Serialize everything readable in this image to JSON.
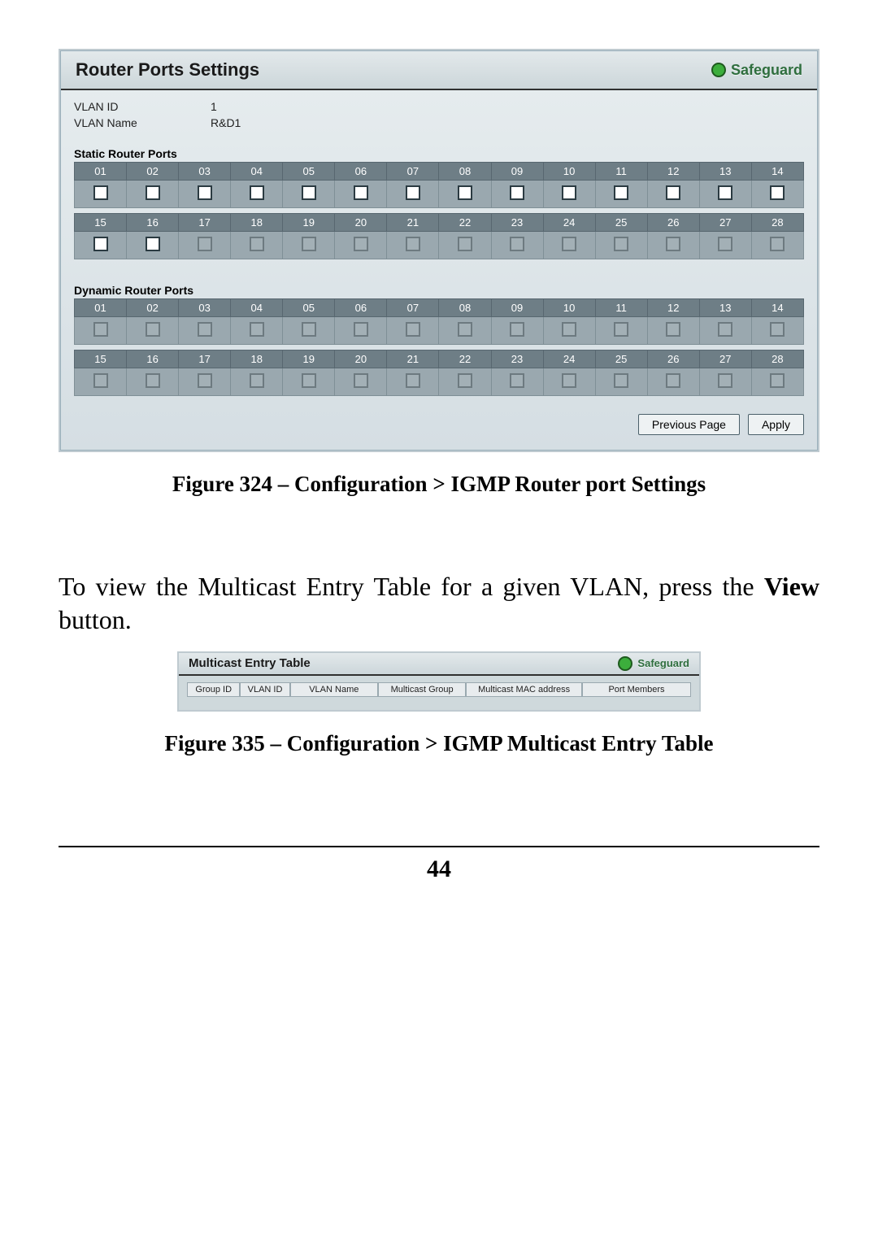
{
  "figure1": {
    "title": "Router Ports Settings",
    "safeguard_label": "Safeguard",
    "vlan_id_label": "VLAN ID",
    "vlan_id_value": "1",
    "vlan_name_label": "VLAN Name",
    "vlan_name_value": "R&D1",
    "static_section": "Static Router Ports",
    "dynamic_section": "Dynamic Router Ports",
    "ports_row1": [
      "01",
      "02",
      "03",
      "04",
      "05",
      "06",
      "07",
      "08",
      "09",
      "10",
      "11",
      "12",
      "13",
      "14"
    ],
    "ports_row2": [
      "15",
      "16",
      "17",
      "18",
      "19",
      "20",
      "21",
      "22",
      "23",
      "24",
      "25",
      "26",
      "27",
      "28"
    ],
    "prev_btn": "Previous Page",
    "apply_btn": "Apply"
  },
  "caption1": "Figure 324 – Configuration > IGMP Router port Settings",
  "body": "To view the Multicast Entry Table for a given VLAN, press the ",
  "body_bold": "View",
  "body_tail": " button.",
  "figure2": {
    "title": "Multicast Entry Table",
    "safeguard_label": "Safeguard",
    "cols": [
      "Group ID",
      "VLAN ID",
      "VLAN Name",
      "Multicast Group",
      "Multicast MAC address",
      "Port Members"
    ]
  },
  "caption2": "Figure 335 – Configuration > IGMP Multicast Entry Table",
  "page_number": "44"
}
